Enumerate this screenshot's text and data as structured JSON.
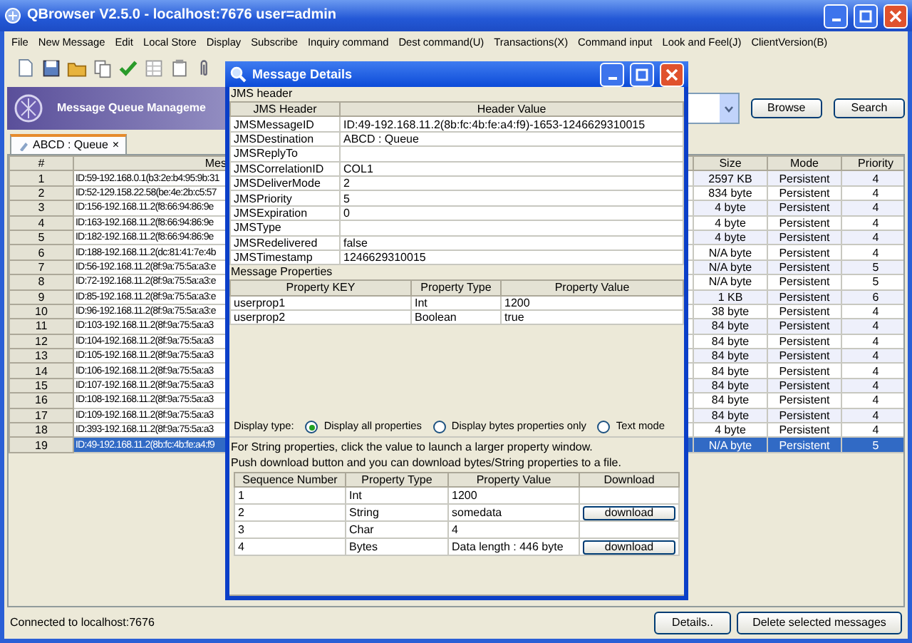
{
  "window": {
    "title": "QBrowser V2.5.0 - localhost:7676 user=admin"
  },
  "menu": [
    "File",
    "New Message",
    "Edit",
    "Local Store",
    "Display",
    "Subscribe",
    "Inquiry command",
    "Dest command(U)",
    "Transactions(X)",
    "Command input",
    "Look and Feel(J)",
    "ClientVersion(B)"
  ],
  "banner": {
    "title": "Message Queue Manageme"
  },
  "buttons": [
    "Browse",
    "Search"
  ],
  "tabs": [
    {
      "label": "ABCD : Queue",
      "close": "×",
      "selected": true
    }
  ],
  "messages": {
    "columns": [
      "#",
      "Mes",
      "Size",
      "Mode",
      "Priority"
    ],
    "rows": [
      {
        "number": "1",
        "id": "ID:59-192.168.0.1(b3:2e:b4:95:9b:31",
        "size": "2597 KB",
        "mode": "Persistent",
        "priority": "4",
        "selected": false
      },
      {
        "number": "2",
        "id": "ID:52-129.158.22.58(be:4e:2b:c5:57",
        "size": "834 byte",
        "mode": "Persistent",
        "priority": "4",
        "selected": false
      },
      {
        "number": "3",
        "id": "ID:156-192.168.11.2(f8:66:94:86:9e",
        "size": "4 byte",
        "mode": "Persistent",
        "priority": "4",
        "selected": false
      },
      {
        "number": "4",
        "id": "ID:163-192.168.11.2(f8:66:94:86:9e",
        "size": "4 byte",
        "mode": "Persistent",
        "priority": "4",
        "selected": false
      },
      {
        "number": "5",
        "id": "ID:182-192.168.11.2(f8:66:94:86:9e",
        "size": "4 byte",
        "mode": "Persistent",
        "priority": "4",
        "selected": false
      },
      {
        "number": "6",
        "id": "ID:188-192.168.11.2(dc:81:41:7e:4b",
        "size": "N/A byte",
        "mode": "Persistent",
        "priority": "4",
        "selected": false
      },
      {
        "number": "7",
        "id": "ID:56-192.168.11.2(8f:9a:75:5a:a3:e",
        "size": "N/A byte",
        "mode": "Persistent",
        "priority": "5",
        "selected": false
      },
      {
        "number": "8",
        "id": "ID:72-192.168.11.2(8f:9a:75:5a:a3:e",
        "size": "N/A byte",
        "mode": "Persistent",
        "priority": "5",
        "selected": false
      },
      {
        "number": "9",
        "id": "ID:85-192.168.11.2(8f:9a:75:5a:a3:e",
        "size": "1 KB",
        "mode": "Persistent",
        "priority": "6",
        "selected": false
      },
      {
        "number": "10",
        "id": "ID:96-192.168.11.2(8f:9a:75:5a:a3:e",
        "size": "38 byte",
        "mode": "Persistent",
        "priority": "4",
        "selected": false
      },
      {
        "number": "11",
        "id": "ID:103-192.168.11.2(8f:9a:75:5a:a3",
        "size": "84 byte",
        "mode": "Persistent",
        "priority": "4",
        "selected": false
      },
      {
        "number": "12",
        "id": "ID:104-192.168.11.2(8f:9a:75:5a:a3",
        "size": "84 byte",
        "mode": "Persistent",
        "priority": "4",
        "selected": false
      },
      {
        "number": "13",
        "id": "ID:105-192.168.11.2(8f:9a:75:5a:a3",
        "size": "84 byte",
        "mode": "Persistent",
        "priority": "4",
        "selected": false
      },
      {
        "number": "14",
        "id": "ID:106-192.168.11.2(8f:9a:75:5a:a3",
        "size": "84 byte",
        "mode": "Persistent",
        "priority": "4",
        "selected": false
      },
      {
        "number": "15",
        "id": "ID:107-192.168.11.2(8f:9a:75:5a:a3",
        "size": "84 byte",
        "mode": "Persistent",
        "priority": "4",
        "selected": false
      },
      {
        "number": "16",
        "id": "ID:108-192.168.11.2(8f:9a:75:5a:a3",
        "size": "84 byte",
        "mode": "Persistent",
        "priority": "4",
        "selected": false
      },
      {
        "number": "17",
        "id": "ID:109-192.168.11.2(8f:9a:75:5a:a3",
        "size": "84 byte",
        "mode": "Persistent",
        "priority": "4",
        "selected": false
      },
      {
        "number": "18",
        "id": "ID:393-192.168.11.2(8f:9a:75:5a:a3",
        "size": "4 byte",
        "mode": "Persistent",
        "priority": "4",
        "selected": false
      },
      {
        "number": "19",
        "id": "ID:49-192.168.11.2(8b:fc:4b:fe:a4:f9",
        "size": "N/A byte",
        "mode": "Persistent",
        "priority": "5",
        "selected": true
      }
    ]
  },
  "status_bar": {
    "text": "Connected to localhost:7676",
    "buttons": [
      "Details..",
      "Delete selected messages"
    ]
  },
  "dialog": {
    "title": "Message Details",
    "jms_header": {
      "label": "JMS header",
      "columns": [
        "JMS Header",
        "Header Value"
      ],
      "rows": [
        {
          "name": "JMSMessageID",
          "value": "ID:49-192.168.11.2(8b:fc:4b:fe:a4:f9)-1653-1246629310015"
        },
        {
          "name": "JMSDestination",
          "value": "ABCD : Queue"
        },
        {
          "name": "JMSReplyTo"
        },
        {
          "name": "JMSCorrelationID",
          "value": "COL1"
        },
        {
          "name": "JMSDeliverMode",
          "value": "2"
        },
        {
          "name": "JMSPriority",
          "value": "5"
        },
        {
          "name": "JMSExpiration",
          "value": "0"
        },
        {
          "name": "JMSType"
        },
        {
          "name": "JMSRedelivered",
          "value": "false"
        },
        {
          "name": "JMSTimestamp",
          "value": "1246629310015"
        }
      ]
    },
    "properties": {
      "label": "Message Properties",
      "columns": [
        "Property KEY",
        "Property Type",
        "Property Value"
      ],
      "rows": [
        {
          "key": "userprop1",
          "type": "Int",
          "value": "1200"
        },
        {
          "key": "userprop2",
          "type": "Boolean",
          "value": "true"
        }
      ]
    },
    "display_type": {
      "label": "Display type:",
      "options": [
        {
          "label": "Display all properties",
          "selected": true
        },
        {
          "label": "Display bytes properties only",
          "selected": false
        },
        {
          "label": "Text mode",
          "selected": false
        }
      ]
    },
    "notes": [
      "For String properties, click the value to launch a larger property window.",
      "Push download button and you can download bytes/String properties to a file."
    ],
    "property_values": {
      "columns": [
        "Sequence Number",
        "Property Type",
        "Property Value",
        "Download"
      ],
      "rows": [
        {
          "sequence": "1",
          "type": "Int",
          "value": "1200"
        },
        {
          "sequence": "2",
          "type": "String",
          "value": "somedata",
          "download": "download"
        },
        {
          "sequence": "3",
          "type": "Char",
          "value": "4"
        },
        {
          "sequence": "4",
          "type": "Bytes",
          "value": "Data length : 446 byte",
          "download": "download"
        }
      ]
    }
  }
}
